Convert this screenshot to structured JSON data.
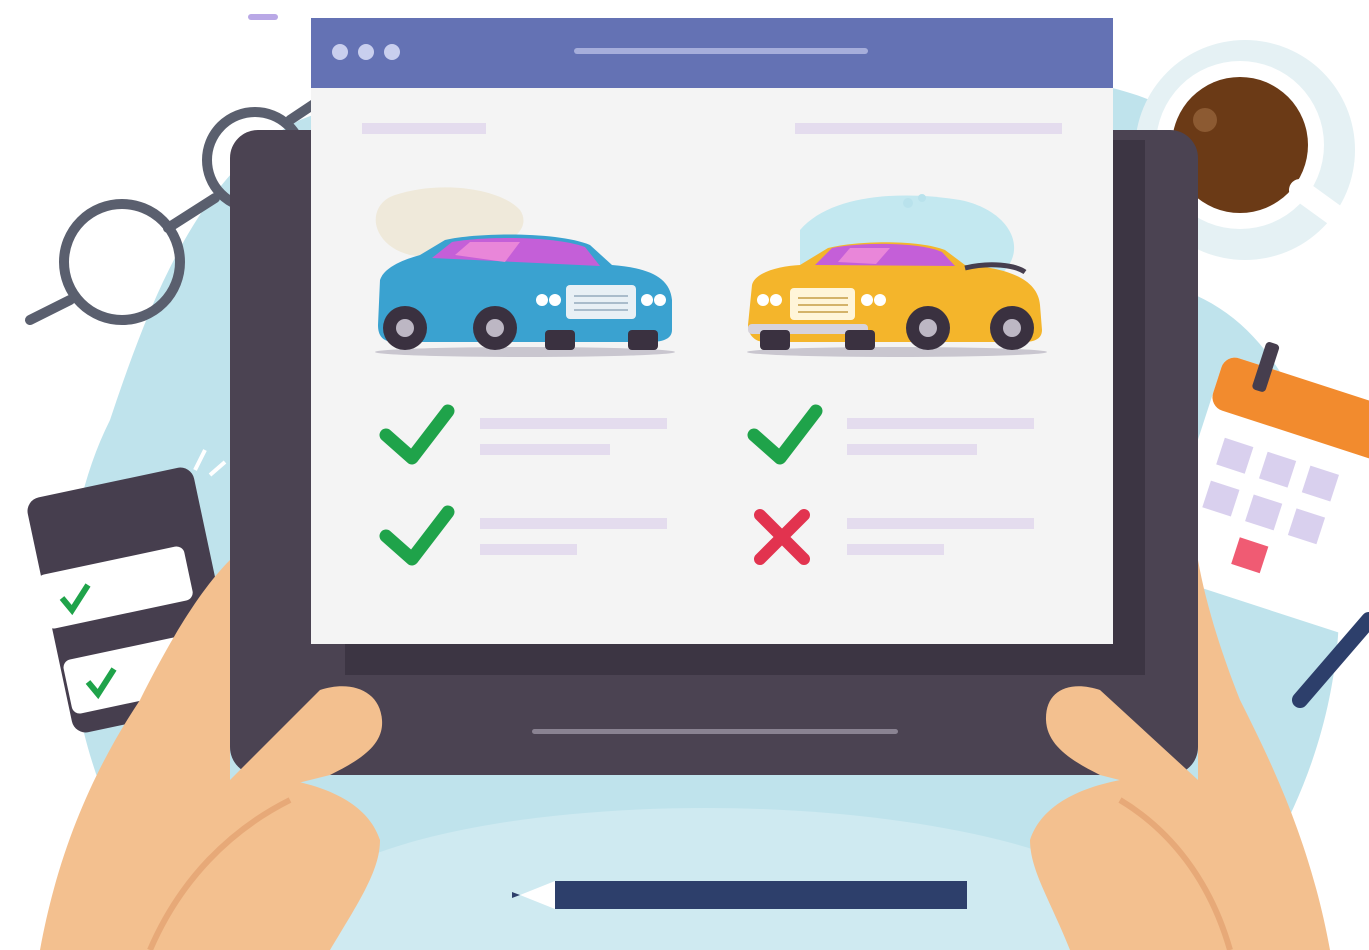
{
  "scene": {
    "description_free": true,
    "colors": {
      "background_blob": "#bfe3ec",
      "tablet_body": "#4b4352",
      "tablet_screen": "#3c3543",
      "browser_titlebar": "#6472b4",
      "browser_page": "#f4f4f4",
      "placeholder_line": "#e4dcee",
      "check_green": "#1fa34a",
      "cross_red": "#e2334f",
      "skin": "#f3c08f",
      "skin_shadow": "#e7a978",
      "blue_car": "#3aa2d0",
      "yellow_car": "#f4b52b",
      "coffee": "#6b3a16",
      "pencil": "#2d3f6b"
    },
    "left_column": {
      "car_icon": "blue-sedan-icon",
      "rows": [
        {
          "status": "check",
          "icon": "check-icon"
        },
        {
          "status": "check",
          "icon": "check-icon"
        }
      ]
    },
    "right_column": {
      "car_icon": "yellow-convertible-icon",
      "rows": [
        {
          "status": "check",
          "icon": "check-icon"
        },
        {
          "status": "cross",
          "icon": "cross-icon"
        }
      ]
    },
    "window_controls": [
      "dot-icon",
      "dot-icon",
      "dot-icon"
    ]
  }
}
